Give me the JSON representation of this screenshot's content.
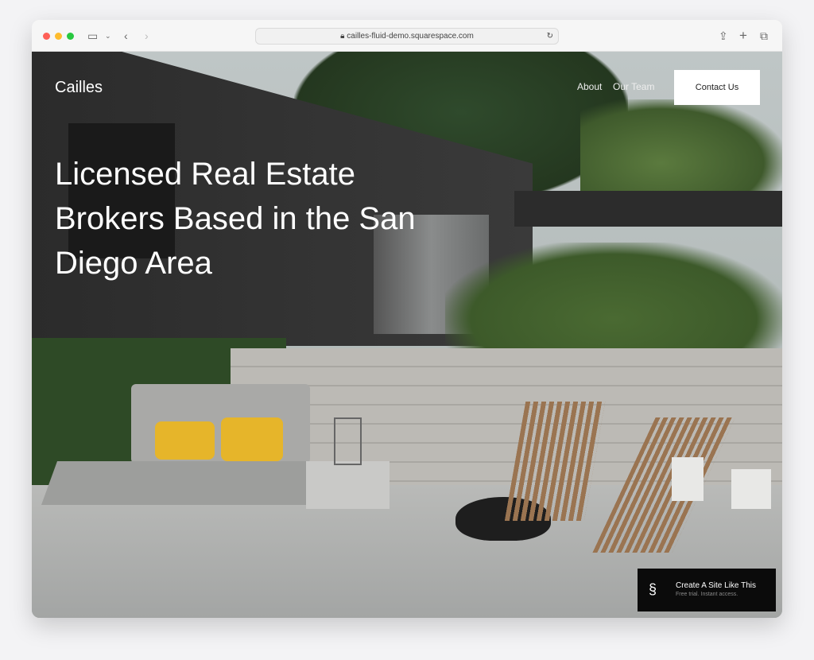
{
  "browser": {
    "url": "cailles-fluid-demo.squarespace.com"
  },
  "site": {
    "logo": "Cailles",
    "nav": [
      "About",
      "Our Team"
    ],
    "contact_label": "Contact Us",
    "headline": "Licensed Real Estate Brokers Based in the San Diego Area"
  },
  "badge": {
    "title": "Create A Site Like This",
    "subtitle": "Free trial. Instant access."
  }
}
